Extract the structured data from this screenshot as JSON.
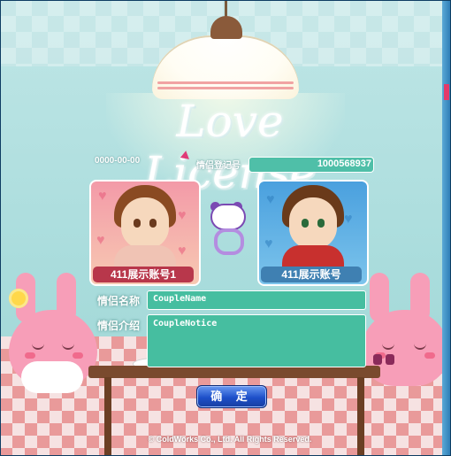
{
  "title": "Love License",
  "date": "0000-00-00",
  "registration": {
    "label": "情侣登记号",
    "number": "1000568937"
  },
  "couple": {
    "left_name": "411展示账号1",
    "right_name": "411展示账号"
  },
  "fields": {
    "name_label": "情侣名称",
    "name_value": "CoupleName",
    "intro_label": "情侣介绍",
    "intro_value": "CoupleNotice"
  },
  "confirm_label": "确 定",
  "copyright": "© ColdWorks Co., Ltd. All Rights Reserved.",
  "colors": {
    "field_bg": "#46bea0",
    "button": "#1d4fc9",
    "left_namebar": "#b8374b",
    "right_namebar": "#3f80b2"
  },
  "icons": [
    "panda-ring-icon",
    "pointer-cursor-icon",
    "heart-icon"
  ]
}
